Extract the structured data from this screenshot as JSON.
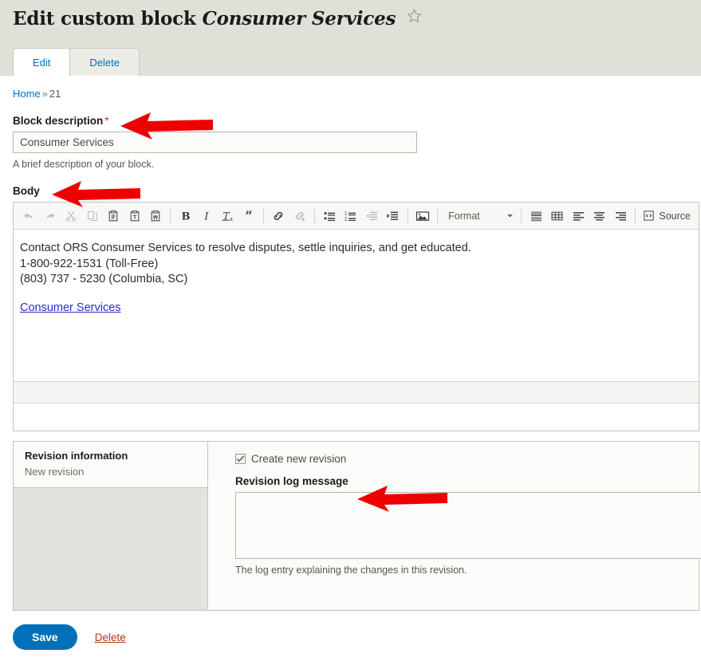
{
  "header": {
    "title_prefix": "Edit custom block",
    "title_entity": "Consumer Services",
    "star_icon": "star-outline-icon"
  },
  "tabs": [
    {
      "label": "Edit",
      "active": true
    },
    {
      "label": "Delete",
      "active": false
    }
  ],
  "breadcrumb": {
    "home": "Home",
    "separator": "»",
    "current": "21"
  },
  "fields": {
    "block_description": {
      "label": "Block description",
      "required_marker": "*",
      "value": "Consumer Services",
      "placeholder": "",
      "description": "A brief description of your block."
    },
    "body": {
      "label": "Body"
    }
  },
  "editor": {
    "format_label": "Format",
    "source_label": "Source",
    "toolbar_groups": [
      {
        "buttons": [
          {
            "name": "undo-icon",
            "title": "Undo",
            "disabled": true
          },
          {
            "name": "redo-icon",
            "title": "Redo",
            "disabled": true
          },
          {
            "name": "cut-icon",
            "title": "Cut",
            "disabled": true
          },
          {
            "name": "copy-icon",
            "title": "Copy",
            "disabled": true
          },
          {
            "name": "paste-icon",
            "title": "Paste",
            "disabled": false
          },
          {
            "name": "paste-text-icon",
            "title": "Paste as plain text",
            "disabled": false
          },
          {
            "name": "paste-word-icon",
            "title": "Paste from Word",
            "disabled": false
          }
        ]
      },
      {
        "buttons": [
          {
            "name": "bold-icon",
            "title": "Bold",
            "disabled": false
          },
          {
            "name": "italic-icon",
            "title": "Italic",
            "disabled": false
          },
          {
            "name": "remove-format-icon",
            "title": "Remove Format",
            "disabled": false
          },
          {
            "name": "blockquote-icon",
            "title": "Block Quote",
            "disabled": false
          }
        ]
      },
      {
        "buttons": [
          {
            "name": "link-icon",
            "title": "Link",
            "disabled": false
          },
          {
            "name": "unlink-icon",
            "title": "Unlink",
            "disabled": true
          }
        ]
      },
      {
        "buttons": [
          {
            "name": "bulleted-list-icon",
            "title": "Bulleted list",
            "disabled": false
          },
          {
            "name": "numbered-list-icon",
            "title": "Numbered list",
            "disabled": false
          },
          {
            "name": "outdent-icon",
            "title": "Decrease indent",
            "disabled": true
          },
          {
            "name": "indent-icon",
            "title": "Increase indent",
            "disabled": false
          }
        ]
      },
      {
        "buttons": [
          {
            "name": "image-icon",
            "title": "Image",
            "disabled": false
          }
        ]
      },
      {
        "buttons": [
          {
            "name": "horizontal-rule-icon",
            "title": "Horizontal line",
            "disabled": false
          },
          {
            "name": "table-icon",
            "title": "Table",
            "disabled": false
          },
          {
            "name": "align-left-icon",
            "title": "Align left",
            "disabled": false
          },
          {
            "name": "align-center-icon",
            "title": "Center",
            "disabled": false
          },
          {
            "name": "align-right-icon",
            "title": "Align right",
            "disabled": false
          }
        ]
      }
    ],
    "content": {
      "line1": "Contact ORS Consumer Services to resolve disputes, settle inquiries, and get educated.",
      "line2": "1-800-922-1531 (Toll-Free)",
      "line3": "(803) 737 - 5230 (Columbia, SC)",
      "link": "Consumer Services"
    }
  },
  "revision": {
    "tab_title": "Revision information",
    "tab_summary": "New revision",
    "checkbox_label": "Create new revision",
    "checkbox_checked": true,
    "log_label": "Revision log message",
    "log_value": "",
    "log_placeholder": "",
    "log_description": "The log entry explaining the changes in this revision."
  },
  "actions": {
    "save_label": "Save",
    "delete_label": "Delete"
  },
  "annotations": [
    {
      "name": "arrow-block-description",
      "target": "Block description"
    },
    {
      "name": "arrow-body",
      "target": "Body"
    },
    {
      "name": "arrow-revision-log",
      "target": "Revision log message"
    }
  ],
  "colors": {
    "accent_blue": "#0071b8",
    "header_bg": "#e0e0d8",
    "required_red": "#d02020",
    "delete_red": "#b5361c",
    "annotation_red": "#ee0000"
  }
}
